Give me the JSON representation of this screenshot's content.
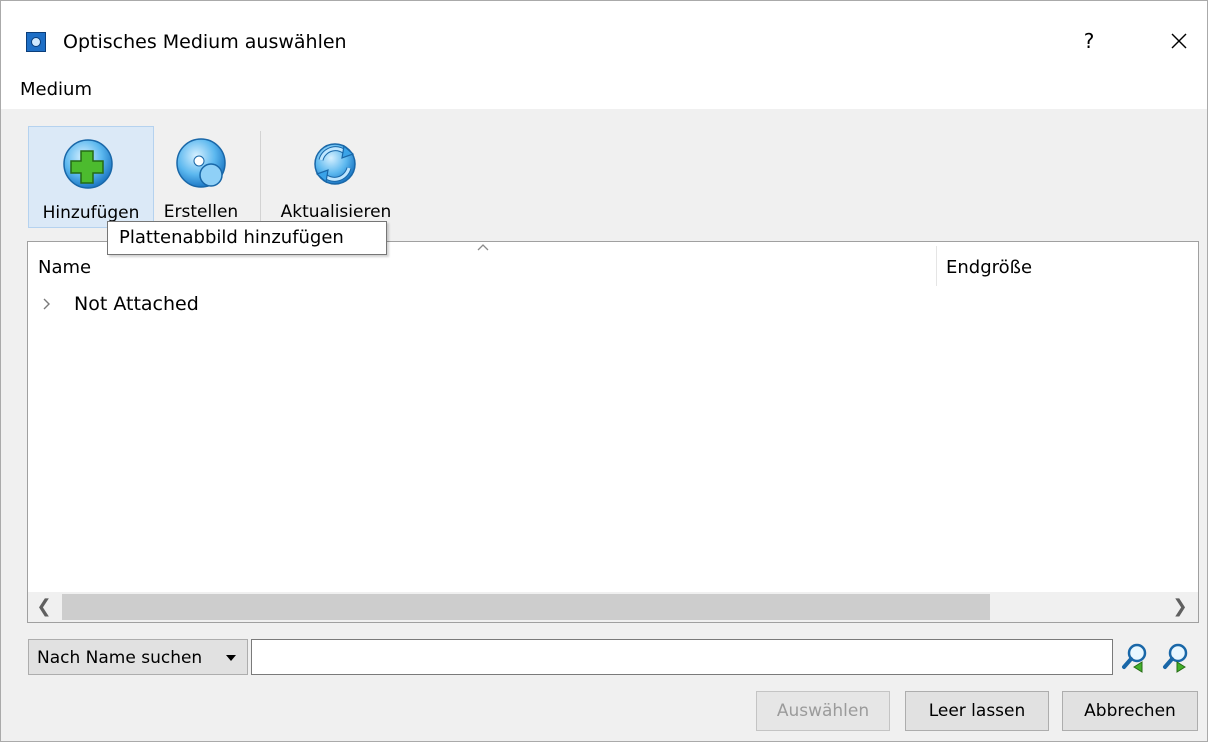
{
  "window": {
    "title": "Optisches Medium auswählen",
    "help_label": "?",
    "app_icon": "virtualbox-icon",
    "close_icon": "close-icon"
  },
  "menu": {
    "items": [
      "Medium"
    ]
  },
  "toolbar": {
    "buttons": [
      {
        "label": "Hinzufügen",
        "icon": "add-disk-icon",
        "hovered": true
      },
      {
        "label": "Erstellen",
        "icon": "create-disk-icon",
        "hovered": false
      },
      {
        "label": "Aktualisieren",
        "icon": "refresh-icon",
        "hovered": false
      }
    ]
  },
  "tooltip": {
    "text": "Plattenabbild hinzufügen"
  },
  "tree": {
    "columns": [
      "Name",
      "Endgröße"
    ],
    "sorted_column": "Name",
    "rows": [
      {
        "label": "Not Attached",
        "expanded": false
      }
    ]
  },
  "search": {
    "type_label": "Nach Name suchen",
    "value": "",
    "prev_icon": "search-previous-icon",
    "next_icon": "search-next-icon"
  },
  "buttons": {
    "select": "Auswählen",
    "leave_empty": "Leer lassen",
    "cancel": "Abbrechen",
    "select_enabled": false
  },
  "colors": {
    "hover_bg": "#dbe9f7",
    "icon_blue": "#3aa3e8",
    "plus_green": "#43b02a"
  }
}
